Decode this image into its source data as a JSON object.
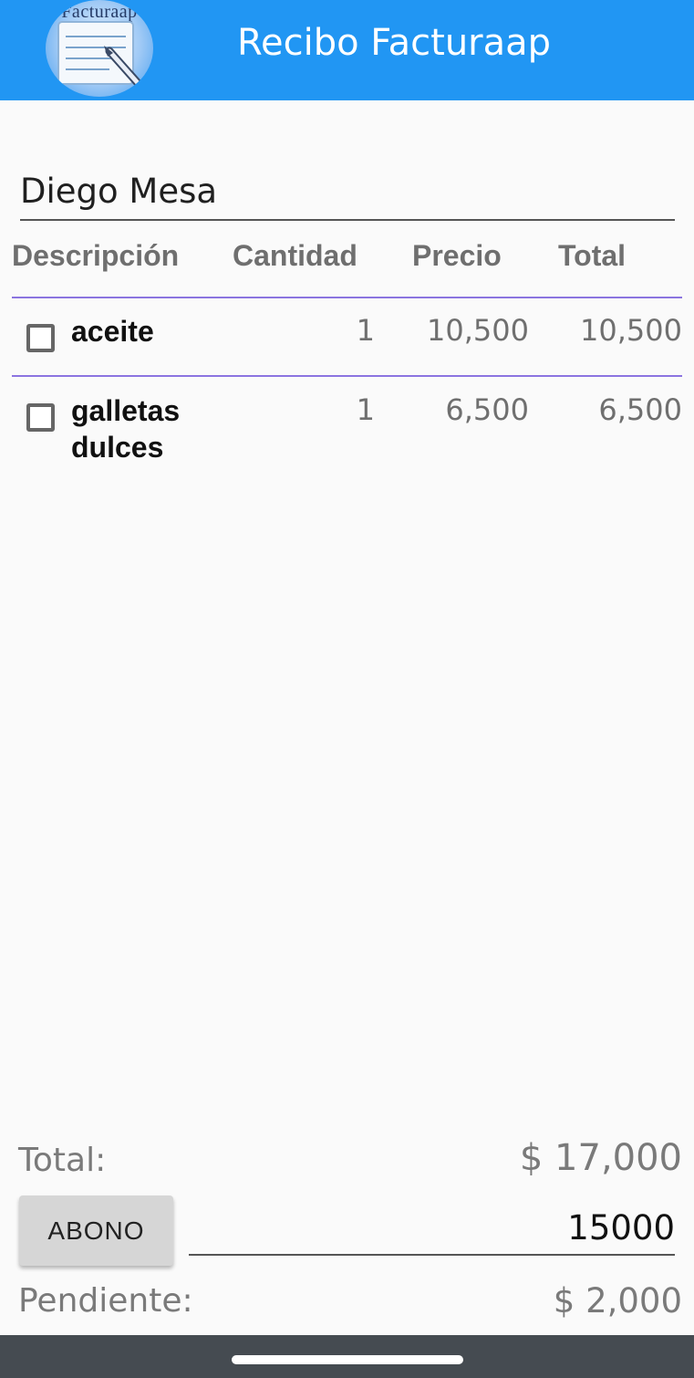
{
  "appbar": {
    "logo_text": "Facturaap",
    "title": "Recibo Facturaap",
    "color": "#2196f3"
  },
  "client": {
    "name": "Diego Mesa"
  },
  "table": {
    "headers": [
      "Descripción",
      "Cantidad",
      "Precio",
      "Total"
    ],
    "rows": [
      {
        "checked": false,
        "description_lines": [
          "aceite"
        ],
        "quantity": "1",
        "price": "10,500",
        "total": "10,500"
      },
      {
        "checked": false,
        "description_lines": [
          "galletas",
          "dulces"
        ],
        "quantity": "1",
        "price": "6,500",
        "total": "6,500"
      }
    ],
    "separator_color": "#8b74e0"
  },
  "summary": {
    "total_label": "Total:",
    "total_value": "$ 17,000",
    "abono_button": "ABONO",
    "abono_value": "15000",
    "pending_label": "Pendiente:",
    "pending_value": "$ 2,000"
  }
}
